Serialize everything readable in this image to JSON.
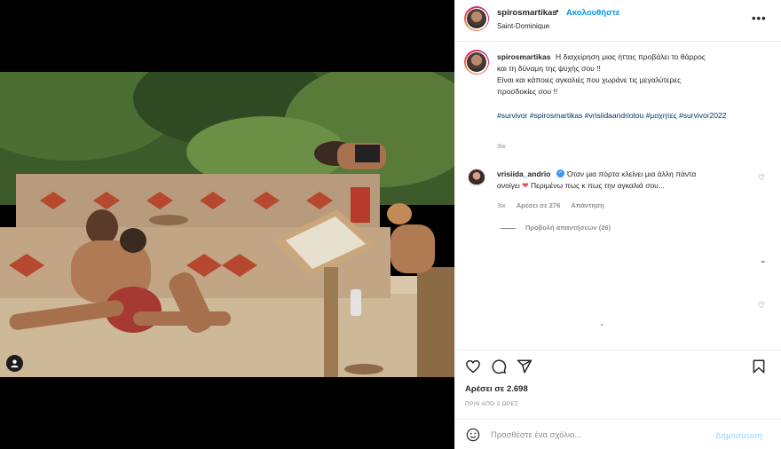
{
  "header": {
    "username": "spirosmartikas",
    "separator": "•",
    "follow_label": "Ακολουθήστε",
    "location": "Saint-Dominique",
    "more_label": "•••"
  },
  "caption": {
    "username": "spirosmartikas",
    "line1": "Η διαχείρηση μιας ήττας προβάλει το θάρρος",
    "line2": "και τη δύναμη της ψυχής σου !!",
    "line3": "Είναι και κάποιες αγκαλιές που χωράνε τις μεγαλύτερες",
    "line4": "προσδοκίες σου !!",
    "hashtags": "#survivor #spirosmartikas #vrisiidaandriotou #μαχητες #survivor2022",
    "time": "3w"
  },
  "comment": {
    "username": "vrisiida_andrio",
    "text1": "Όταν μια πόρτα κλείνει μια άλλη πάντα",
    "text2_a": "ανοίγει",
    "text2_b": " Περιμένω πως κ πως την αγκαλιά σου...",
    "time": "3w",
    "likes": "Αρέσει σε 276",
    "reply_label": "Απάντηση",
    "view_replies": "Προβολή απαντήσεων (26)"
  },
  "actions": {
    "likes": "Αρέσει σε 2.698",
    "ago": "ΠΡΙΝ ΑΠΌ 3 ΏΡΕΣ"
  },
  "add_comment": {
    "placeholder": "Προσθέστε ένα σχόλιο...",
    "post_label": "Δημοσίευση"
  },
  "colors": {
    "accent": "#0095f6",
    "hashtag": "#00376b",
    "muted": "#8e8e8e",
    "like_red": "#ed4956"
  }
}
